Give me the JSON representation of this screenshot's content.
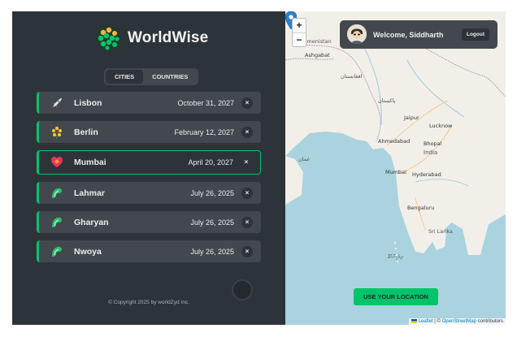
{
  "app": {
    "brand": "WorldWise",
    "tabs": [
      {
        "label": "Cities",
        "active": true
      },
      {
        "label": "Countries",
        "active": false
      }
    ],
    "cities": [
      {
        "name": "Lisbon",
        "date": "October 31, 2027",
        "emoji": "rocket-icon",
        "active": false
      },
      {
        "name": "Berlin",
        "date": "February 12, 2027",
        "emoji": "sunflower-icon",
        "active": false
      },
      {
        "name": "Mumbai",
        "date": "April 20, 2027",
        "emoji": "heart-icon",
        "active": true
      },
      {
        "name": "Lahmar",
        "date": "July 26, 2025",
        "emoji": "flag-icon",
        "active": false
      },
      {
        "name": "Gharyan",
        "date": "July 26, 2025",
        "emoji": "flag-icon",
        "active": false
      },
      {
        "name": "Nwoya",
        "date": "July 26, 2025",
        "emoji": "flag-icon",
        "active": false
      }
    ],
    "delete_symbol": "×",
    "copyright": "© Copyright 2025 by worldZyd Inc."
  },
  "map": {
    "zoom_in": "+",
    "zoom_out": "−",
    "user": {
      "welcome": "Welcome, Siddharth",
      "logout": "Logout"
    },
    "locate_button": "Use your location",
    "attribution": {
      "leaflet": "Leaflet",
      "sep": " | © ",
      "osm": "OpenStreetMap",
      "contrib": " contributors"
    },
    "labels": {
      "turkmenistan": "rkmenistan",
      "ashgabat": "Ashgabat",
      "afghanistan": "افغانستان",
      "pakistan": "پاکستان",
      "jaipur": "Jaipur",
      "lucknow": "Lucknow",
      "ahmedabad": "Ahmedabad",
      "bhopal": "Bhopal",
      "india": "India",
      "mumbai": "Mumbai",
      "hyderabad": "Hyderabad",
      "bengaluru": "Bengaluru",
      "sri_lanka": "Sri Lanka",
      "oman": "عمان",
      "maldives": "ދިވެހިރާއްޖޭ"
    },
    "colors": {
      "land": "#f2efe9",
      "water": "#aad3df",
      "accent": "#00c46a"
    }
  }
}
